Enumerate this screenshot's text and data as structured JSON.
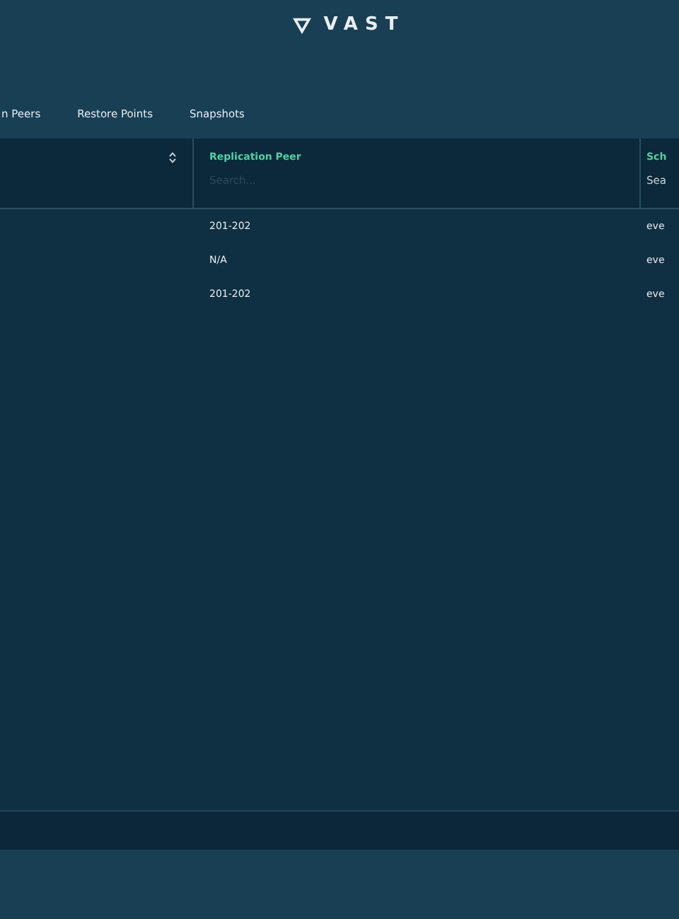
{
  "logo": {
    "text": "VAST"
  },
  "tabs": [
    {
      "label": "n Peers",
      "selected": false
    },
    {
      "label": "Restore Points",
      "selected": false
    },
    {
      "label": "Snapshots",
      "selected": false
    }
  ],
  "table": {
    "columns": [
      {
        "sortable": true
      },
      {
        "title": "Replication Peer",
        "search": {
          "placeholder": "Search..."
        }
      },
      {
        "title": "Sch",
        "search": {
          "placeholder": "Sea"
        }
      }
    ],
    "rows": [
      [
        "",
        "201-202",
        "eve"
      ],
      [
        "",
        "N/A",
        "eve"
      ],
      [
        "",
        "201-202",
        "eve"
      ]
    ]
  }
}
